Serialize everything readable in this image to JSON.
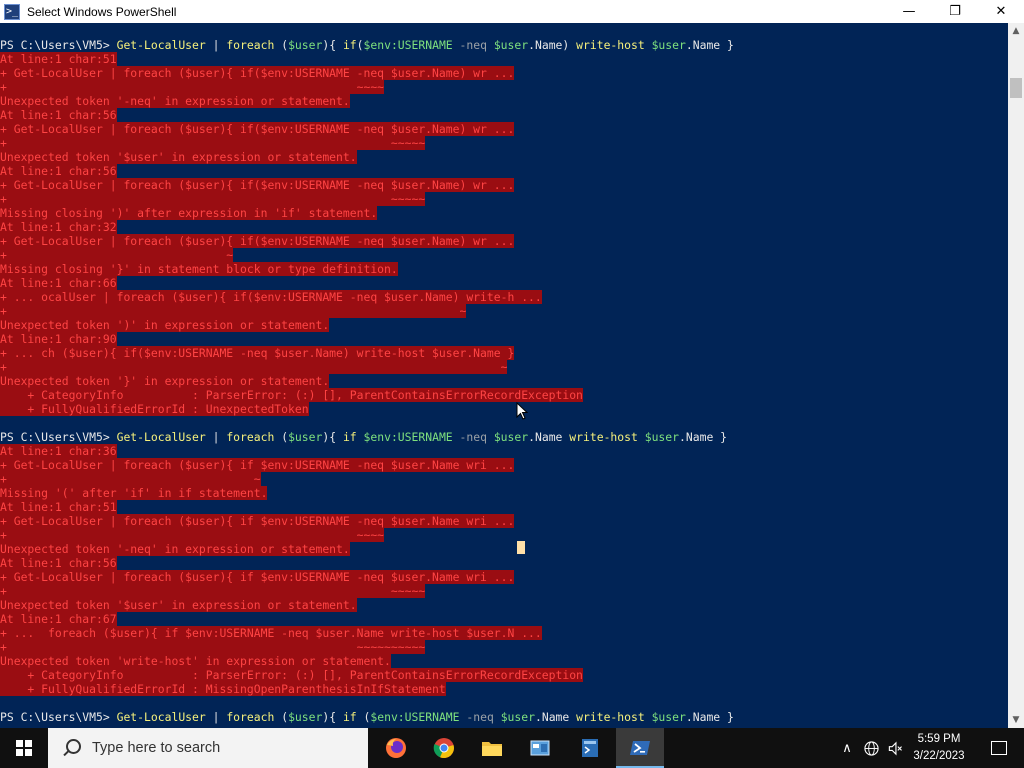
{
  "window": {
    "title": "Select Windows PowerShell",
    "app_icon": "powershell-icon",
    "controls": {
      "minimize": "—",
      "maximize": "❐",
      "close": "✕"
    }
  },
  "console": {
    "lines": [
      {
        "type": "prompt",
        "prompt": "PS C:\\Users\\VM5>",
        "segments": [
          [
            "cmd",
            "Get-LocalUser"
          ],
          [
            "str",
            " | "
          ],
          [
            "cmd",
            "foreach"
          ],
          [
            "str",
            " ("
          ],
          [
            "var",
            "$user"
          ],
          [
            "str",
            "){ "
          ],
          [
            "cmd",
            "if"
          ],
          [
            "str",
            "("
          ],
          [
            "var",
            "$env:USERNAME"
          ],
          [
            "op",
            " -neq "
          ],
          [
            "var",
            "$user"
          ],
          [
            "str",
            ".Name) "
          ],
          [
            "cmd",
            "write-host"
          ],
          [
            "str",
            " "
          ],
          [
            "var",
            "$user"
          ],
          [
            "str",
            ".Name }"
          ]
        ]
      },
      {
        "type": "err",
        "text": "At line:1 char:51"
      },
      {
        "type": "err",
        "text": "+ Get-LocalUser | foreach ($user){ if($env:USERNAME -neq $user.Name) wr ..."
      },
      {
        "type": "err",
        "text": "+                                                   ~~~~"
      },
      {
        "type": "err",
        "text": "Unexpected token '-neq' in expression or statement."
      },
      {
        "type": "err",
        "text": "At line:1 char:56"
      },
      {
        "type": "err",
        "text": "+ Get-LocalUser | foreach ($user){ if($env:USERNAME -neq $user.Name) wr ..."
      },
      {
        "type": "err",
        "text": "+                                                        ~~~~~"
      },
      {
        "type": "err",
        "text": "Unexpected token '$user' in expression or statement."
      },
      {
        "type": "err",
        "text": "At line:1 char:56"
      },
      {
        "type": "err",
        "text": "+ Get-LocalUser | foreach ($user){ if($env:USERNAME -neq $user.Name) wr ..."
      },
      {
        "type": "err",
        "text": "+                                                        ~~~~~"
      },
      {
        "type": "err",
        "text": "Missing closing ')' after expression in 'if' statement."
      },
      {
        "type": "err",
        "text": "At line:1 char:32"
      },
      {
        "type": "err",
        "text": "+ Get-LocalUser | foreach ($user){ if($env:USERNAME -neq $user.Name) wr ..."
      },
      {
        "type": "err",
        "text": "+                                ~"
      },
      {
        "type": "err",
        "text": "Missing closing '}' in statement block or type definition."
      },
      {
        "type": "err",
        "text": "At line:1 char:66"
      },
      {
        "type": "err",
        "text": "+ ... ocalUser | foreach ($user){ if($env:USERNAME -neq $user.Name) write-h ..."
      },
      {
        "type": "err",
        "text": "+                                                                  ~"
      },
      {
        "type": "err",
        "text": "Unexpected token ')' in expression or statement."
      },
      {
        "type": "err",
        "text": "At line:1 char:90"
      },
      {
        "type": "err",
        "text": "+ ... ch ($user){ if($env:USERNAME -neq $user.Name) write-host $user.Name }"
      },
      {
        "type": "err",
        "text": "+                                                                        ~"
      },
      {
        "type": "err",
        "text": "Unexpected token '}' in expression or statement."
      },
      {
        "type": "err",
        "text": "    + CategoryInfo          : ParserError: (:) [], ParentContainsErrorRecordException"
      },
      {
        "type": "err",
        "text": "    + FullyQualifiedErrorId : UnexpectedToken"
      },
      {
        "type": "blank"
      },
      {
        "type": "prompt",
        "prompt": "PS C:\\Users\\VM5>",
        "segments": [
          [
            "cmd",
            "Get-LocalUser"
          ],
          [
            "str",
            " | "
          ],
          [
            "cmd",
            "foreach"
          ],
          [
            "str",
            " ("
          ],
          [
            "var",
            "$user"
          ],
          [
            "str",
            "){ "
          ],
          [
            "cmd",
            "if"
          ],
          [
            "str",
            " "
          ],
          [
            "var",
            "$env:USERNAME"
          ],
          [
            "op",
            " -neq "
          ],
          [
            "var",
            "$user"
          ],
          [
            "str",
            ".Name "
          ],
          [
            "cmd",
            "write-host"
          ],
          [
            "str",
            " "
          ],
          [
            "var",
            "$user"
          ],
          [
            "str",
            ".Name }"
          ]
        ]
      },
      {
        "type": "err",
        "text": "At line:1 char:36"
      },
      {
        "type": "err",
        "text": "+ Get-LocalUser | foreach ($user){ if $env:USERNAME -neq $user.Name wri ..."
      },
      {
        "type": "err",
        "text": "+                                    ~"
      },
      {
        "type": "err",
        "text": "Missing '(' after 'if' in if statement."
      },
      {
        "type": "err",
        "text": "At line:1 char:51"
      },
      {
        "type": "err",
        "text": "+ Get-LocalUser | foreach ($user){ if $env:USERNAME -neq $user.Name wri ..."
      },
      {
        "type": "err",
        "text": "+                                                   ~~~~"
      },
      {
        "type": "err",
        "text": "Unexpected token '-neq' in expression or statement."
      },
      {
        "type": "err",
        "text": "At line:1 char:56"
      },
      {
        "type": "err",
        "text": "+ Get-LocalUser | foreach ($user){ if $env:USERNAME -neq $user.Name wri ..."
      },
      {
        "type": "err",
        "text": "+                                                        ~~~~~"
      },
      {
        "type": "err",
        "text": "Unexpected token '$user' in expression or statement."
      },
      {
        "type": "err",
        "text": "At line:1 char:67"
      },
      {
        "type": "err",
        "text": "+ ...  foreach ($user){ if $env:USERNAME -neq $user.Name write-host $user.N ..."
      },
      {
        "type": "err",
        "text": "+                                                   ~~~~~~~~~~"
      },
      {
        "type": "err",
        "text": "Unexpected token 'write-host' in expression or statement."
      },
      {
        "type": "err",
        "text": "    + CategoryInfo          : ParserError: (:) [], ParentContainsErrorRecordException"
      },
      {
        "type": "err",
        "text": "    + FullyQualifiedErrorId : MissingOpenParenthesisInIfStatement"
      },
      {
        "type": "blank"
      },
      {
        "type": "prompt",
        "prompt": "PS C:\\Users\\VM5>",
        "segments": [
          [
            "cmd",
            "Get-LocalUser"
          ],
          [
            "str",
            " | "
          ],
          [
            "cmd",
            "foreach"
          ],
          [
            "str",
            " ("
          ],
          [
            "var",
            "$user"
          ],
          [
            "str",
            "){ "
          ],
          [
            "cmd",
            "if"
          ],
          [
            "str",
            " ("
          ],
          [
            "var",
            "$env:USERNAME"
          ],
          [
            "op",
            " -neq "
          ],
          [
            "var",
            "$user"
          ],
          [
            "str",
            ".Name "
          ],
          [
            "cmd",
            "write-host"
          ],
          [
            "str",
            " "
          ],
          [
            "var",
            "$user"
          ],
          [
            "str",
            ".Name }"
          ]
        ]
      }
    ]
  },
  "taskbar": {
    "search_placeholder": "Type here to search",
    "apps": [
      {
        "name": "firefox-icon",
        "glyph": ""
      },
      {
        "name": "chrome-icon",
        "glyph": ""
      },
      {
        "name": "file-explorer-icon",
        "glyph": ""
      },
      {
        "name": "control-panel-icon",
        "glyph": ""
      },
      {
        "name": "powershell-ise-icon",
        "glyph": ""
      },
      {
        "name": "powershell-icon",
        "glyph": "",
        "active": true
      }
    ],
    "tray": {
      "chevron": "∧",
      "network": "🌐",
      "volume": "🔇"
    },
    "clock": {
      "time": "5:59 PM",
      "date": "3/22/2023"
    }
  }
}
